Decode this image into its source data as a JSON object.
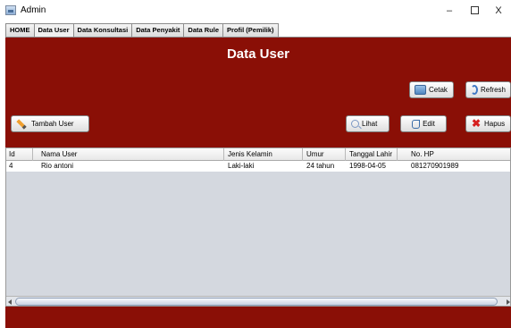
{
  "window": {
    "title": "Admin",
    "minimize_glyph": "–",
    "close_glyph": "X"
  },
  "tabs": [
    {
      "label": "HOME"
    },
    {
      "label": "Data User",
      "active": true
    },
    {
      "label": "Data Konsultasi"
    },
    {
      "label": "Data Penyakit"
    },
    {
      "label": "Data Rule"
    },
    {
      "label": "Profil (Pemilik)"
    }
  ],
  "page": {
    "title": "Data User",
    "background_color": "#8a0f06"
  },
  "buttons": {
    "cetak": "Cetak",
    "refresh": "Refresh",
    "tambah_user": "Tambah User",
    "lihat": "Lihat",
    "edit": "Edit",
    "hapus": "Hapus"
  },
  "icons": {
    "cetak": "printer-icon",
    "refresh": "refresh-icon",
    "tambah_user": "pencil-icon",
    "lihat": "search-icon",
    "edit": "edit-icon",
    "hapus": "delete-icon"
  },
  "table": {
    "columns": [
      "Id",
      "Nama User",
      "Jenis Kelamin",
      "Umur",
      "Tanggal Lahir",
      "No. HP"
    ],
    "rows": [
      [
        "4",
        "Rio antoni",
        "Laki-laki",
        "24 tahun",
        "1998-04-05",
        "081270901989"
      ]
    ]
  }
}
